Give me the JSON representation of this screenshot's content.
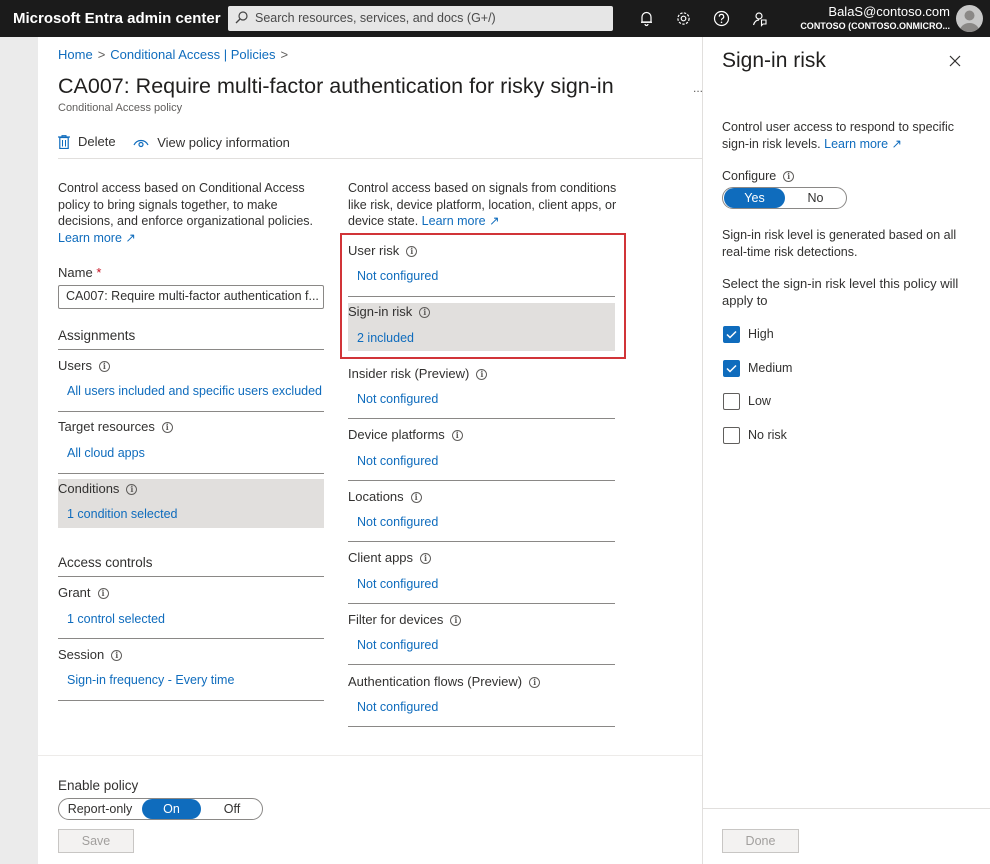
{
  "topbar": {
    "app_title": "Microsoft Entra admin center",
    "search_placeholder": "Search resources, services, and docs (G+/)",
    "user_name": "BalaS@contoso.com",
    "tenant": "CONTOSO (CONTOSO.ONMICRO..."
  },
  "breadcrumb": [
    "Home",
    "Conditional Access | Policies"
  ],
  "page": {
    "title": "CA007: Require multi-factor authentication for risky sign-in",
    "ellipsis": "...",
    "subtitle": "Conditional Access policy"
  },
  "commands": {
    "delete": "Delete",
    "view_info": "View policy information"
  },
  "left": {
    "description": "Control access based on Conditional Access policy to bring signals together, to make decisions, and enforce organizational policies.",
    "learn_more": "Learn more",
    "name_label": "Name",
    "name_required": "*",
    "name_value": "CA007: Require multi-factor authentication f...",
    "assignments_heading": "Assignments",
    "users_label": "Users",
    "users_value": "All users included and specific users excluded",
    "target_label": "Target resources",
    "target_value": "All cloud apps",
    "conditions_label": "Conditions",
    "conditions_value": "1 condition selected",
    "access_heading": "Access controls",
    "grant_label": "Grant",
    "grant_value": "1 control selected",
    "session_label": "Session",
    "session_value": "Sign-in frequency - Every time"
  },
  "conditions": {
    "description": "Control access based on signals from conditions like risk, device platform, location, client apps, or device state.",
    "learn_more": "Learn more",
    "items": [
      {
        "label": "User risk",
        "value": "Not configured"
      },
      {
        "label": "Sign-in risk",
        "value": "2 included"
      },
      {
        "label": "Insider risk (Preview)",
        "value": "Not configured"
      },
      {
        "label": "Device platforms",
        "value": "Not configured"
      },
      {
        "label": "Locations",
        "value": "Not configured"
      },
      {
        "label": "Client apps",
        "value": "Not configured"
      },
      {
        "label": "Filter for devices",
        "value": "Not configured"
      },
      {
        "label": "Authentication flows (Preview)",
        "value": "Not configured"
      }
    ]
  },
  "enable_policy": {
    "label": "Enable policy",
    "options": [
      "Report-only",
      "On",
      "Off"
    ],
    "selected": "On",
    "save": "Save"
  },
  "panel": {
    "title": "Sign-in risk",
    "intro": "Control user access to respond to specific sign-in risk levels.",
    "learn_more": "Learn more",
    "configure_label": "Configure",
    "configure_options": [
      "Yes",
      "No"
    ],
    "configure_selected": "Yes",
    "generated_text": "Sign-in risk level is generated based on all real-time risk detections.",
    "select_text": "Select the sign-in risk level this policy will apply to",
    "levels": [
      {
        "label": "High",
        "checked": true
      },
      {
        "label": "Medium",
        "checked": true
      },
      {
        "label": "Low",
        "checked": false
      },
      {
        "label": "No risk",
        "checked": false
      }
    ],
    "done": "Done"
  },
  "colors": {
    "accent": "#0f6cbd",
    "highlight_border": "#d13438",
    "topbar": "#1b1b1b"
  }
}
